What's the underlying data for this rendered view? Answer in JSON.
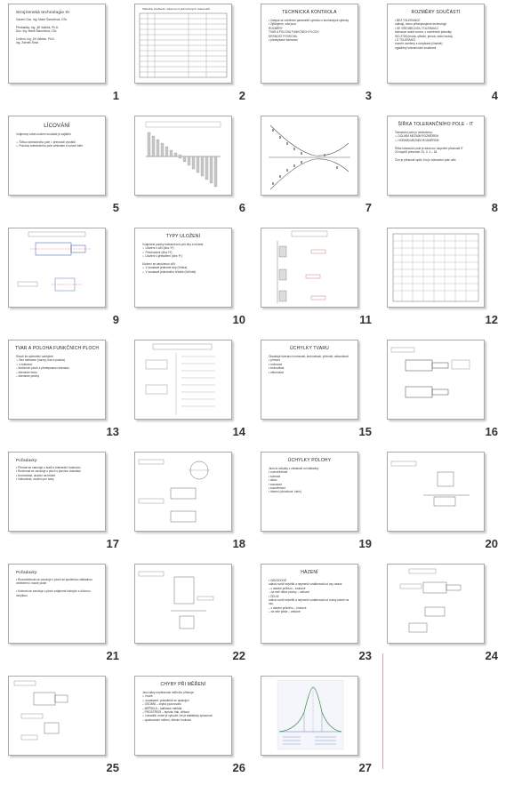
{
  "slides": [
    {
      "num": "1",
      "title": "Strojírenská technologie III",
      "lines": "Garant: Doc. Ing. Marie Šamoňová, CSc\n\nPřednášky: Ing. Jiří Valíček, Ph.D.\nDoc. Ing. Marie Šamoňová, CSc\n\nCvičení: Ing. Jiří Valíček, Ph.D.\nIng. Zdeněk Šmíd"
    },
    {
      "num": "2",
      "title": "Tabulka přehledu vlastností jednotlivých materiálů",
      "lines": ""
    },
    {
      "num": "3",
      "title": "TECHNICKÁ KONTROLA",
      "lines": "• Zabývá se ověřením parametrů výrobku s technickými výkresy\n• Zjišťujeme, zda jsou:\n  ROZMĚRY\n  TVAR A POLOHA FUNKČNÍCH PLOCH\n  DRSNOST POVRCHU\n• předepsané tolerance"
    },
    {
      "num": "4",
      "title": "ROZMĚRY SOUČÁSTÍ",
      "lines": "• BEZ TOLERANCE\n  udávají, čemu předepisujeme technologii\n• SE VŠEOBECNOU TOLERANCÍ\n  tolerance uvádí norma, v rozměrech jednotky\n  ISO 2768 (hrubá, střední, jemná, velmi hrubá)\n• S TOLERANCÍ\n  rozměr uvedený s úchylkami (číselně)\n  vyjádřený tolerančními značkami"
    },
    {
      "num": "5",
      "title": "LÍCOVÁNÍ",
      "lines": "Vzájemný vztah uložení součástí je zajištěn:\n\n➢ Šířkou tolerančního pole = přesností výrobků\n➢ Polohou tolerančního pole vzhledem k nulové čáře"
    },
    {
      "num": "6",
      "title": "",
      "lines": ""
    },
    {
      "num": "7",
      "title": "",
      "lines": ""
    },
    {
      "num": "8",
      "title": "ŠÍŘKA TOLERANČNÍHO POLE - IT",
      "lines": "Toleranční pole je ohraničeno:\n➢ DOLNÍM MEZNÍM ROZMĚREM\n➢ HORNÍM MEZNÍM ROZMĚREM\n\nŠířka toleranční pole je dána tzv. stupněm přesnosti IT\n20 stupňů přesnosti: 01, 0, 1 – 18\n\nČím je přesnost vyšší, tím je toleranční pole užší"
    },
    {
      "num": "9",
      "title": "",
      "lines": ""
    },
    {
      "num": "10",
      "title": "TYPY ULOŽENÍ",
      "lines": "Vzájemné polohy tolerančních polí díry a hřídele:\n➢ Uložení s vůlí (díra 'H')\n➢ Přechodové (díra 'H')\n➢ Uložení s přesahem (díra 'H')\n\nUložení se zaručenou vůlí:\n➢ V soustavě jednotné díry (H/díra)\n➢ V soustavě jednotného hřídele (h/hřídel)"
    },
    {
      "num": "11",
      "title": "",
      "lines": ""
    },
    {
      "num": "12",
      "title": "",
      "lines": ""
    },
    {
      "num": "13",
      "title": "TVAR A POLOHA FUNKČNÍCH PLOCH",
      "lines": "Slouží ke zpřesnění odchylek:\n➢ Bez tolerance (normy, tvar a poloha)\n➢ s tolerancí\n  – funkčních ploch s předepsanou tolerancí\n  – tolerance tvaru\n  – tolerance polohy"
    },
    {
      "num": "14",
      "title": "",
      "lines": ""
    },
    {
      "num": "15",
      "title": "ÚCHYLKY TVARU",
      "lines": "Obsahuje toleranci rovinnosti, kruhovitosti, přímosti, válcovitosti:\n• přímost\n• rovinnost\n• kruhovitost\n• válcovitost"
    },
    {
      "num": "16",
      "title": "",
      "lines": ""
    },
    {
      "num": "17",
      "title": "Požadavky:",
      "lines": "• Přímost se zaručuje u tvarů s toleranční hodnotou\n• Rovinnost se zaručuje u ploch s plochou dosedací\n• Kruhovitost, uložení na hřídeli\n• Válcovitost, uložení pro tvary"
    },
    {
      "num": "18",
      "title": "",
      "lines": ""
    },
    {
      "num": "19",
      "title": "ÚCHYLKY POLOHY",
      "lines": "Jsou to úchylky v závislosti od základny:\n• rovnoběžnost\n• kolmost\n• sklon\n• souosost\n• souměrnost\n• házení (obvodové, čelní)"
    },
    {
      "num": "20",
      "title": "",
      "lines": ""
    },
    {
      "num": "21",
      "title": "Požadavky:",
      "lines": "• Rovnoběžnost se zaručuje u ploch se společnou základnou vzhledem k nosné ploše\n\n• Kolmost se zaručuje u ploch vzájemně kolmých s úhlovou úchylkou"
    },
    {
      "num": "22",
      "title": "",
      "lines": ""
    },
    {
      "num": "23",
      "title": "HÁZENÍ",
      "lines": "• OBVODOVÉ\n  udává rozdíl největší a nejmenší vzdálenosti od osy rotace\n  – v daném průřezu – kruhové\n  – na celé délce plochy – celkové\n• ČELNÍ\n  udává rozdíl největší a nejmenší vzdálenosti od roviny kolmé na osu\n  – v daném průměru – kruhové\n  – na celé ploše – celkové"
    },
    {
      "num": "24",
      "title": "",
      "lines": ""
    },
    {
      "num": "25",
      "title": "",
      "lines": ""
    },
    {
      "num": "26",
      "title": "CHYBY PŘI MĚŘENÍ",
      "lines": "Jsou dány nepřesností měřicího přístroje:\n➢ hrubé\n➢ soustavné, pravidelně se opakující\n  – OSOBNÍ – chyba pozorování\n  – MĚŘIDLA – kalibrace měřidla\n  – PROSTŘEDÍ – teplota, tlak, vlhkost\n➢ nahodilé, nelze je vyloučit, lze je statisticky zpracovat\n  – opakováním měření, střední hodnota"
    },
    {
      "num": "27",
      "title": "",
      "lines": ""
    }
  ]
}
